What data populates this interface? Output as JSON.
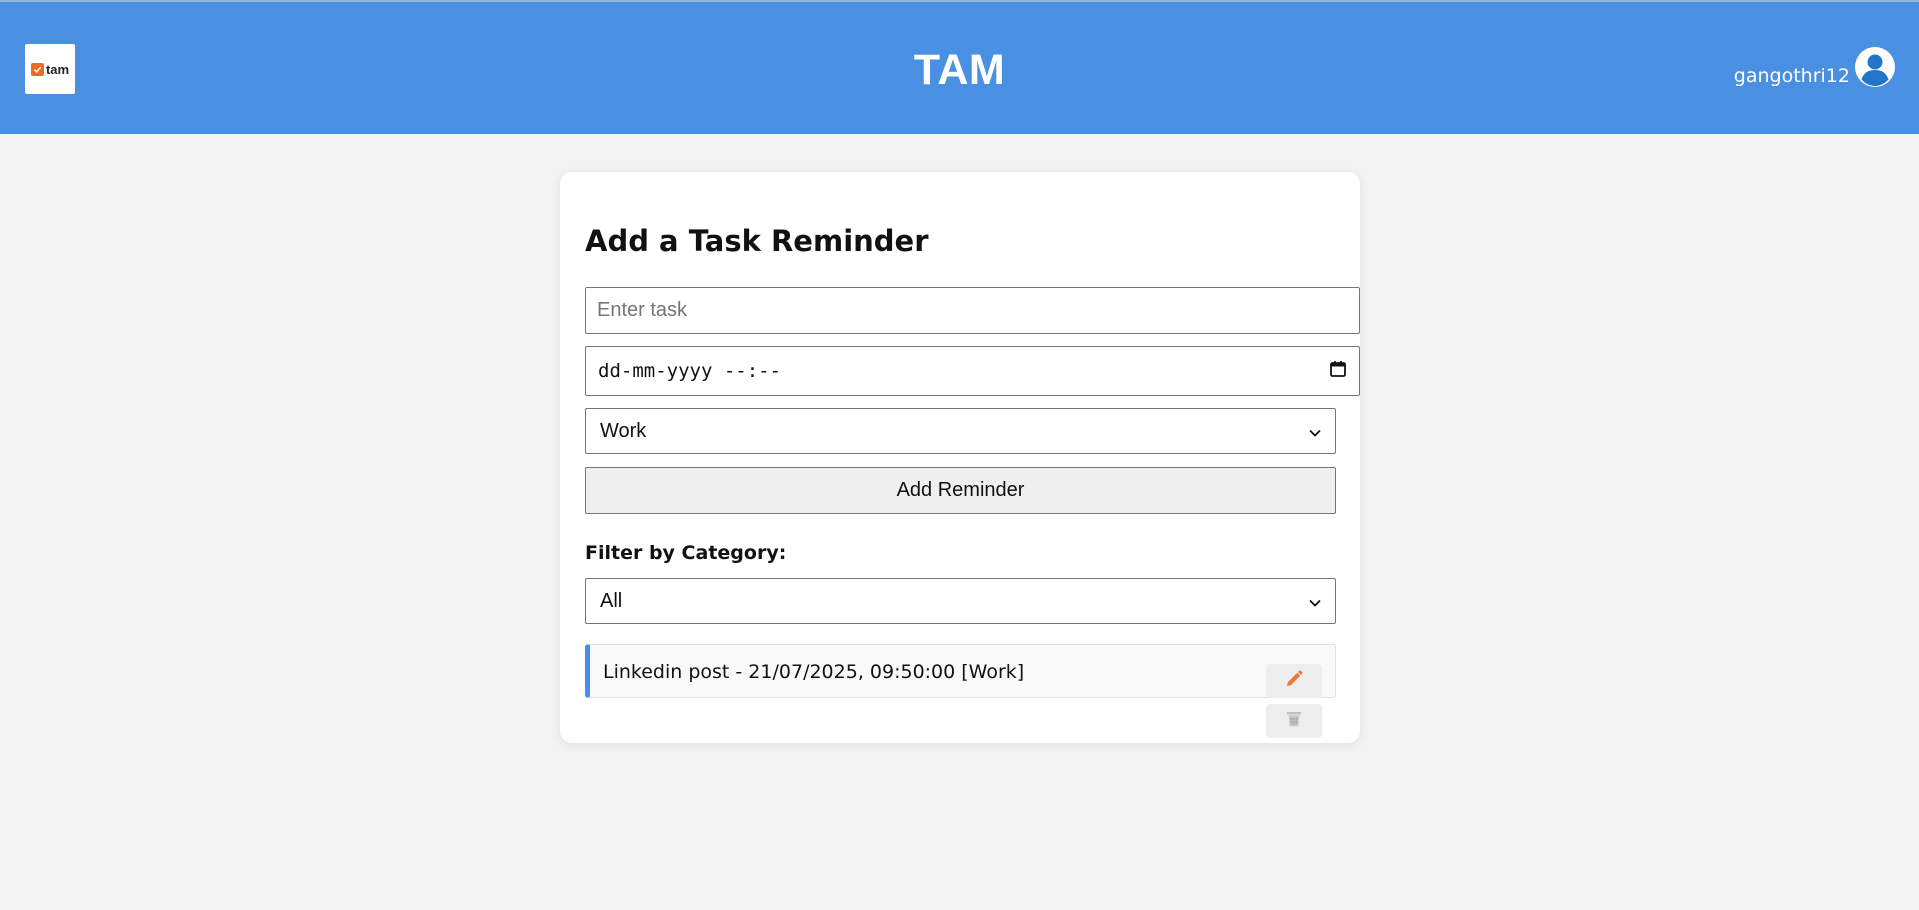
{
  "header": {
    "logo_text": "tam",
    "title": "TAM",
    "username": "gangothri12",
    "avatar_icon": "user-circle-icon",
    "background_color": "#4a90e2"
  },
  "form": {
    "heading": "Add a Task Reminder",
    "task_placeholder": "Enter task",
    "datetime_placeholder": "dd-mm-yyyy --:--",
    "category_value": "Work",
    "add_button_label": "Add Reminder"
  },
  "filter": {
    "label": "Filter by Category:",
    "value": "All"
  },
  "reminders": [
    {
      "text": "Linkedin post - 21/07/2025, 09:50:00 [Work]",
      "accent_color": "#4a90e2",
      "edit_icon": "pencil-icon",
      "delete_icon": "trash-icon"
    }
  ]
}
